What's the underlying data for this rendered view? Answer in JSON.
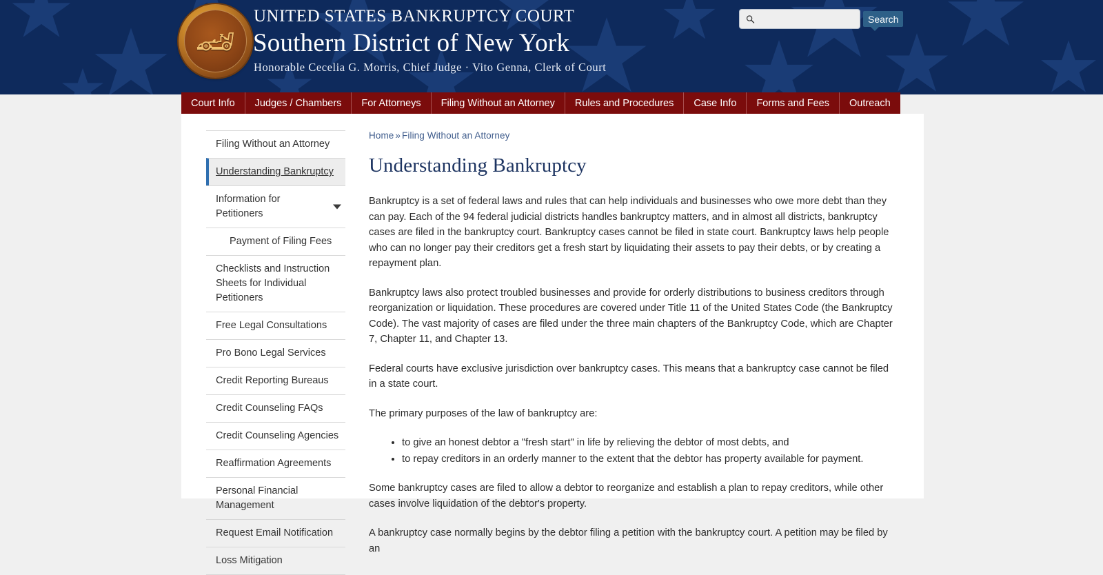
{
  "header": {
    "line1": "UNITED STATES BANKRUPTCY COURT",
    "line2": "Southern District of New York",
    "line3": "Honorable Cecelia G. Morris, Chief Judge · Vito Genna, Clerk of Court",
    "seal_alt": "court-seal",
    "colors": {
      "navy": "#0e2a5c",
      "maroon": "#7b0c0c",
      "accent_blue": "#2f6fb0"
    }
  },
  "search": {
    "value": "",
    "placeholder": "",
    "button_label": "Search",
    "icon": "search-icon"
  },
  "nav": {
    "items": [
      {
        "label": "Court Info"
      },
      {
        "label": "Judges / Chambers"
      },
      {
        "label": "For Attorneys"
      },
      {
        "label": "Filing Without an Attorney"
      },
      {
        "label": "Rules and Procedures"
      },
      {
        "label": "Case Info"
      },
      {
        "label": "Forms and Fees"
      },
      {
        "label": "Outreach"
      }
    ]
  },
  "sidebar": {
    "items": [
      {
        "label": "Filing Without an Attorney",
        "active": false,
        "indent": false,
        "caret": false
      },
      {
        "label": "Understanding Bankruptcy",
        "active": true,
        "indent": false,
        "caret": false
      },
      {
        "label": "Information for Petitioners",
        "active": false,
        "indent": false,
        "caret": true
      },
      {
        "label": "Payment of Filing Fees",
        "active": false,
        "indent": true,
        "caret": false
      },
      {
        "label": "Checklists and Instruction Sheets for Individual Petitioners",
        "active": false,
        "indent": false,
        "caret": false
      },
      {
        "label": "Free Legal Consultations",
        "active": false,
        "indent": false,
        "caret": false
      },
      {
        "label": "Pro Bono Legal Services",
        "active": false,
        "indent": false,
        "caret": false
      },
      {
        "label": "Credit Reporting Bureaus",
        "active": false,
        "indent": false,
        "caret": false
      },
      {
        "label": "Credit Counseling FAQs",
        "active": false,
        "indent": false,
        "caret": false
      },
      {
        "label": "Credit Counseling Agencies",
        "active": false,
        "indent": false,
        "caret": false
      },
      {
        "label": "Reaffirmation Agreements",
        "active": false,
        "indent": false,
        "caret": false
      },
      {
        "label": "Personal Financial Management",
        "active": false,
        "indent": false,
        "caret": false
      },
      {
        "label": "Request Email Notification",
        "active": false,
        "indent": false,
        "caret": false
      },
      {
        "label": "Loss Mitigation",
        "active": false,
        "indent": false,
        "caret": false
      }
    ]
  },
  "breadcrumb": {
    "home": "Home",
    "separator": "»",
    "current": "Filing Without an Attorney"
  },
  "main": {
    "title": "Understanding Bankruptcy",
    "paragraphs": [
      "Bankruptcy is a set of federal laws and rules that can help individuals and businesses who owe more debt than they can pay. Each of the 94 federal judicial districts handles bankruptcy matters, and in almost all districts, bankruptcy cases are filed in the bankruptcy court. Bankruptcy cases cannot be filed in state court. Bankruptcy laws help people who can no longer pay their creditors get a fresh start by liquidating their assets to pay their debts, or by creating a repayment plan.",
      "Bankruptcy laws also protect troubled businesses and provide for orderly distributions to business creditors through reorganization or liquidation. These procedures are covered under Title 11 of the United States Code (the Bankruptcy Code). The vast majority of cases are filed under the three main chapters of the Bankruptcy Code, which are Chapter 7, Chapter 11, and Chapter 13.",
      "Federal courts have exclusive jurisdiction over bankruptcy cases. This means that a bankruptcy case cannot be filed in a state court.",
      "The primary purposes of the law of bankruptcy are:"
    ],
    "list_items": [
      "to give an honest debtor a \"fresh start\" in life by relieving the debtor of most debts, and",
      "to repay creditors in an orderly manner to the extent that the debtor has property available for payment."
    ],
    "paragraphs_after": [
      "Some bankruptcy cases are filed to allow a debtor to reorganize and establish a plan to repay creditors, while other cases involve liquidation of the debtor's property.",
      "A bankruptcy case normally begins by the debtor filing a petition with the bankruptcy court. A petition may be filed by an"
    ]
  }
}
